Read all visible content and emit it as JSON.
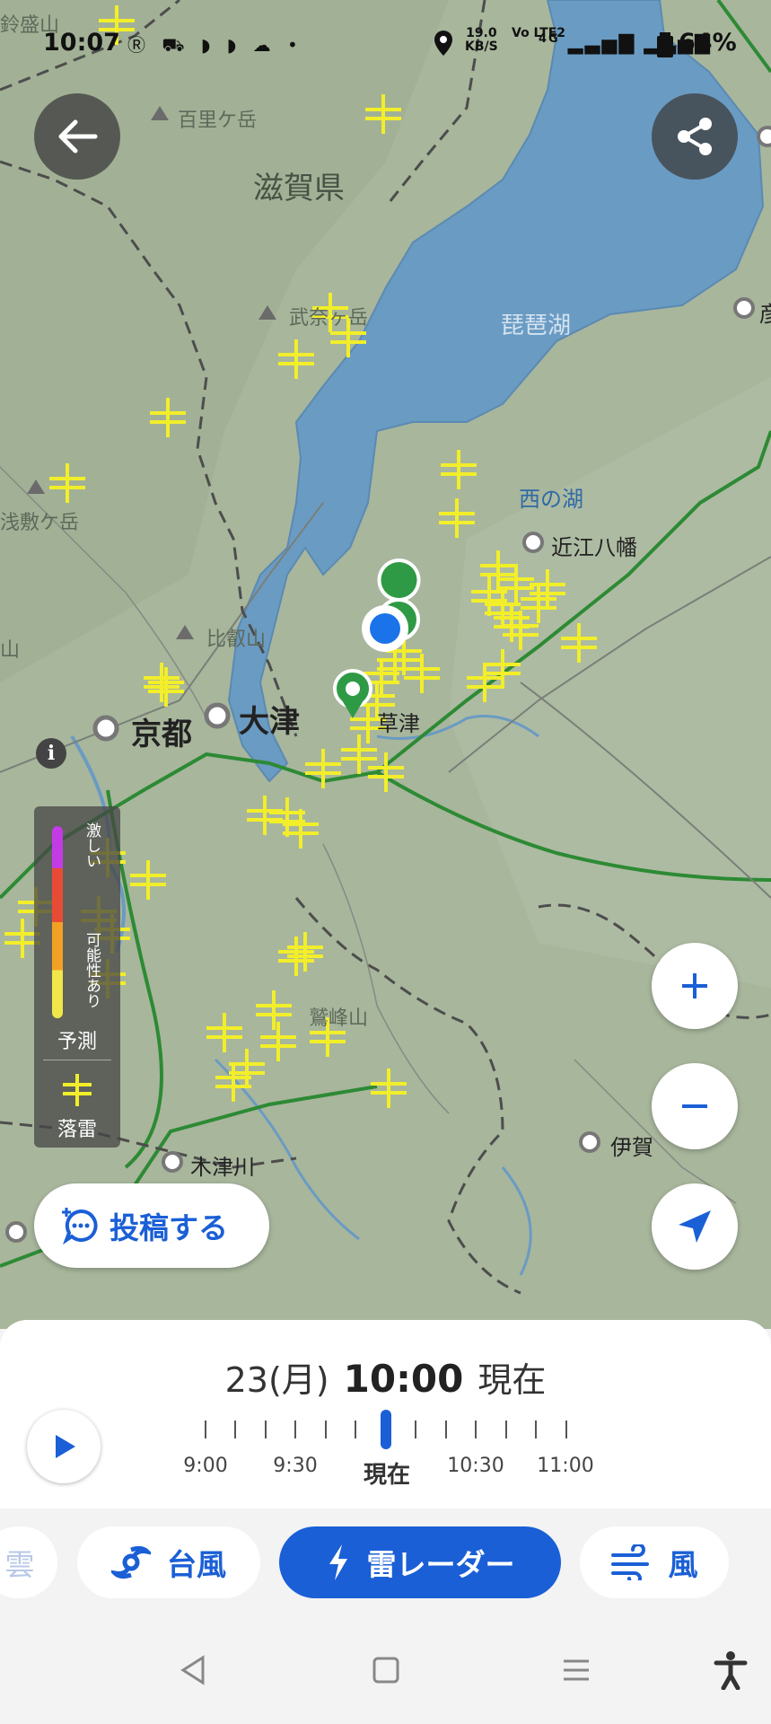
{
  "status_bar": {
    "time": "10:07",
    "left_icons": "Ⓡ ⛟ ◗ ◗ ☁ •",
    "net_speed": "19.0",
    "net_unit": "KB/S",
    "volte": "Vo LTE2",
    "network_type": "4G",
    "battery": "64%"
  },
  "map": {
    "labels": {
      "hyakuriga": "百里ケ岳",
      "shiga": "滋賀県",
      "takeyama": "武奈ヶ岳",
      "biwako": "琵琶湖",
      "nishinoko": "西の湖",
      "omihachiman": "近江八幡",
      "hiei": "比叡山",
      "kyoto": "京都",
      "otsu": "大津",
      "kusatsu": "草津",
      "washimine": "鷲峰山",
      "kizugawa": "木津川",
      "iga": "伊賀",
      "asashiki": "浅敷ケ岳",
      "corner_tl": "鈴盛山",
      "edge_left": "山",
      "edge_right": "彦"
    }
  },
  "legend": {
    "strong": "激しい",
    "possible": "可能性あり",
    "forecast": "予測",
    "lightning": "落雷"
  },
  "buttons": {
    "post_label": "投稿する"
  },
  "timeline": {
    "date": "23(月)",
    "time": "10:00",
    "now_label": "現在",
    "ticks": [
      "9:00",
      "9:30",
      "現在",
      "10:30",
      "11:00"
    ]
  },
  "tabs": {
    "cloud_partial": "雲",
    "typhoon": "台風",
    "lightning_radar": "雷レーダー",
    "wind": "風"
  },
  "colors": {
    "accent": "#1a5fd6",
    "lake": "#6a9bc3",
    "land": "#a9b79d",
    "strike": "#f2ee2a"
  }
}
